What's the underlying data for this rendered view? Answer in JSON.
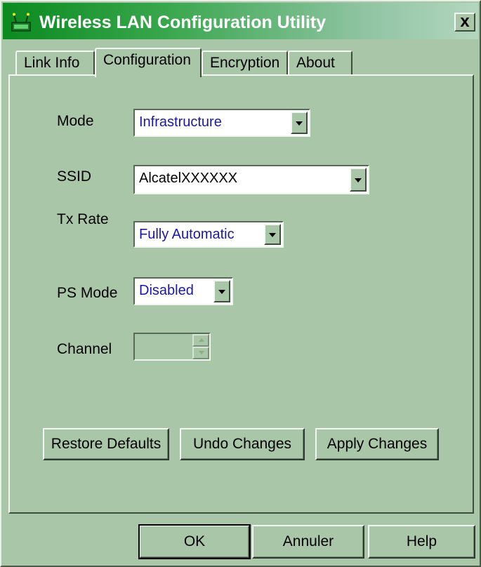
{
  "window": {
    "title": "Wireless LAN Configuration Utility",
    "close_glyph": "x"
  },
  "tabs": [
    {
      "label": "Link Info"
    },
    {
      "label": "Configuration"
    },
    {
      "label": "Encryption"
    },
    {
      "label": "About"
    }
  ],
  "form": {
    "mode": {
      "label": "Mode",
      "value": "Infrastructure"
    },
    "ssid": {
      "label": "SSID",
      "value": "AlcatelXXXXXX"
    },
    "tx_rate": {
      "label": "Tx Rate",
      "value": "Fully Automatic"
    },
    "ps_mode": {
      "label": "PS Mode",
      "value": "Disabled"
    },
    "channel": {
      "label": "Channel",
      "value": ""
    }
  },
  "actions": {
    "restore_defaults": "Restore Defaults",
    "undo_changes": "Undo Changes",
    "apply_changes": "Apply Changes"
  },
  "footer": {
    "ok": "OK",
    "cancel": "Annuler",
    "help": "Help"
  },
  "colors": {
    "dialog_bg": "#a9c6a8",
    "title_gradient_start": "#0b8a1f",
    "combo_text": "#1b1a9b"
  }
}
